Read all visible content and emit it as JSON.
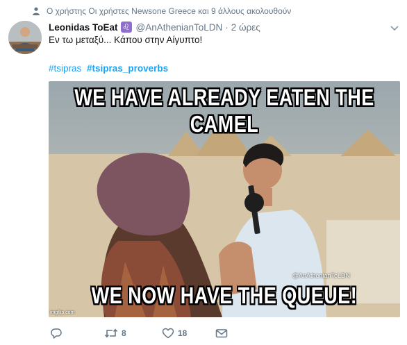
{
  "social_context": {
    "text": "Ο χρήστης Οι χρήστες Newsone Greece και 9 άλλους ακολουθούν",
    "icon": "person-icon"
  },
  "tweet": {
    "fullname": "Leonidas ToEat",
    "badge": "♌",
    "username": "@AnAthenianToLDN",
    "separator": "·",
    "time": "2 ώρες",
    "text": "Εν τω μεταξύ... Κάπου στην Αίγυπτο!",
    "hashtags": [
      {
        "text": "#tsipras",
        "bold": false
      },
      {
        "text": "#tsipras_proverbs",
        "bold": true
      }
    ]
  },
  "media": {
    "top_caption": "WE HAVE ALREADY EATEN THE CAMEL",
    "bottom_caption": "WE NOW HAVE THE QUEUE!",
    "watermark": "@AnAthenianToLDN",
    "source": "imgflip.com"
  },
  "actions": {
    "reply": {
      "icon": "reply-icon",
      "count": ""
    },
    "retweet": {
      "icon": "retweet-icon",
      "count": "8"
    },
    "like": {
      "icon": "heart-icon",
      "count": "18"
    },
    "dm": {
      "icon": "envelope-icon",
      "count": ""
    }
  },
  "colors": {
    "link": "#1da1f2",
    "muted": "#657786",
    "text": "#14171a",
    "badge": "#8e6fd0"
  }
}
